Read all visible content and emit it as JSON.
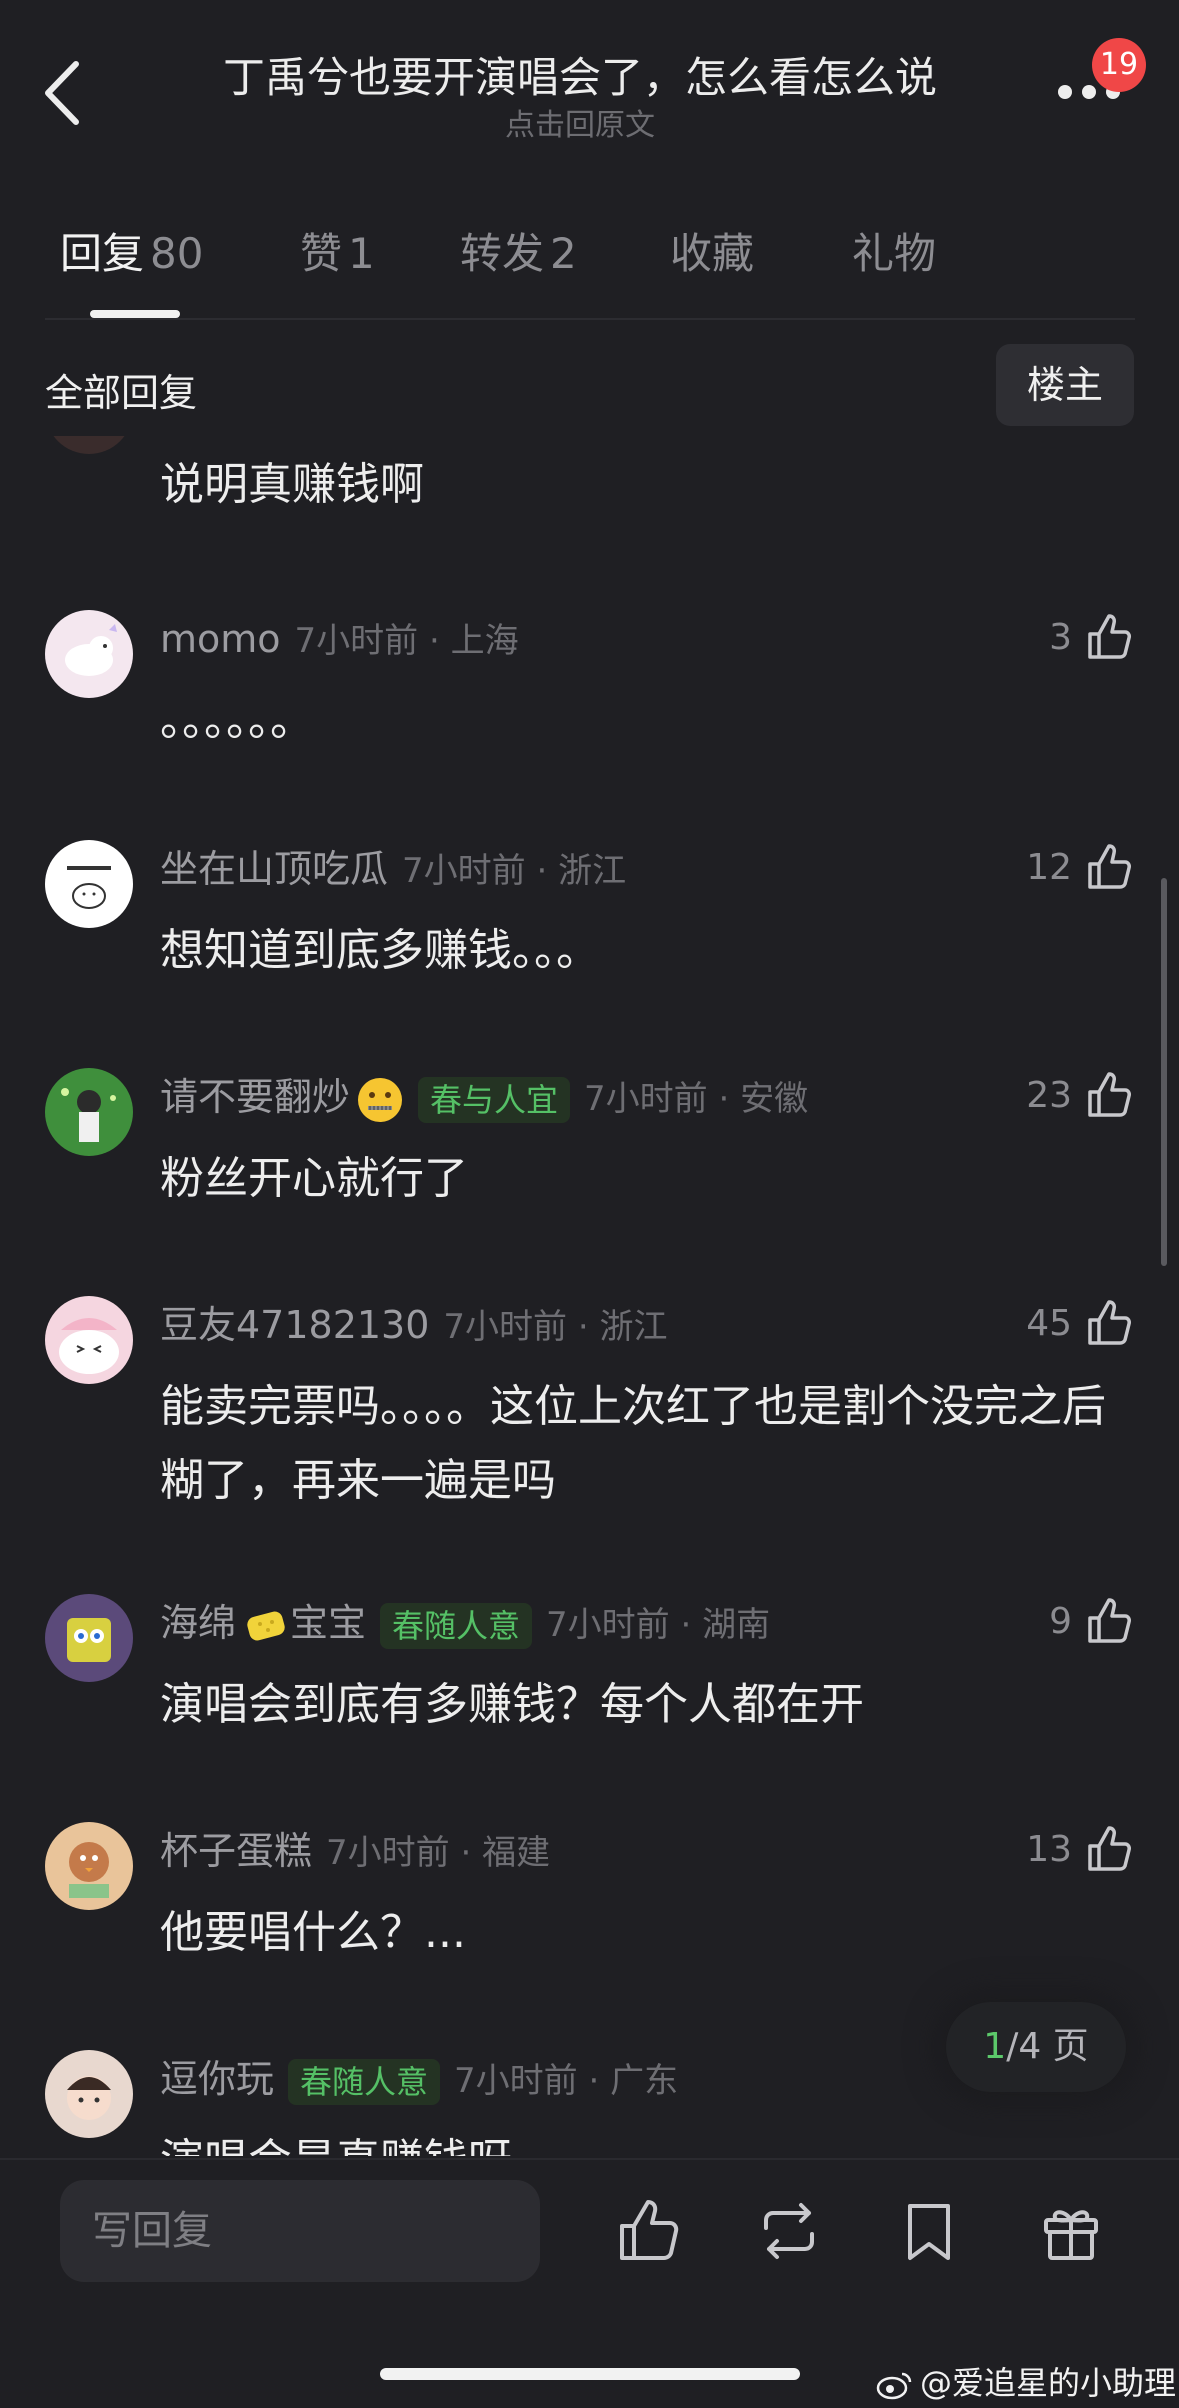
{
  "header": {
    "title": "丁禹兮也要开演唱会了，怎么看怎么说",
    "subtitle": "点击回原文",
    "badge_count": "19"
  },
  "tabs": [
    {
      "label": "回复",
      "count": "80",
      "active": true
    },
    {
      "label": "赞",
      "count": "1",
      "active": false
    },
    {
      "label": "转发",
      "count": "2",
      "active": false
    },
    {
      "label": "收藏",
      "count": "",
      "active": false
    },
    {
      "label": "礼物",
      "count": "",
      "active": false
    }
  ],
  "section": {
    "label": "全部回复",
    "owner_button": "楼主"
  },
  "comments": [
    {
      "name": "",
      "tag": "",
      "time": "",
      "body": "说明真赚钱啊",
      "likes": ""
    },
    {
      "name": "momo",
      "tag": "",
      "time": "7小时前 · 上海",
      "body": "。。。。。。",
      "likes": "3"
    },
    {
      "name": "坐在山顶吃瓜",
      "tag": "",
      "time": "7小时前 · 浙江",
      "body": "想知道到底多赚钱。。。",
      "likes": "12"
    },
    {
      "name": "请不要翻炒",
      "tag": "春与人宜",
      "time": "7小时前 · 安徽",
      "body": "粉丝开心就行了",
      "likes": "23"
    },
    {
      "name": "豆友47182130",
      "tag": "",
      "time": "7小时前 · 浙江",
      "body": "能卖完票吗。。。。这位上次红了也是割个没完之后糊了，再来一遍是吗",
      "likes": "45"
    },
    {
      "name": "海绵",
      "name_suffix": "宝宝",
      "tag": "春随人意",
      "time": "7小时前 · 湖南",
      "body": "演唱会到底有多赚钱？每个人都在开",
      "likes": "9"
    },
    {
      "name": "杯子蛋糕",
      "tag": "",
      "time": "7小时前 · 福建",
      "body": "他要唱什么？...",
      "likes": "13"
    },
    {
      "name": "逗你玩",
      "tag": "春随人意",
      "time": "7小时前 · 广东",
      "body": "演唱会是真赚钱呀",
      "likes": ""
    }
  ],
  "pager": {
    "current": "1",
    "total": "/4 页"
  },
  "bottom_bar": {
    "reply_placeholder": "写回复"
  },
  "watermark": "@爱追星的小助理",
  "colors": {
    "background": "#1f1f23",
    "tag_green": "#55c066",
    "badge_red": "#f04747"
  }
}
